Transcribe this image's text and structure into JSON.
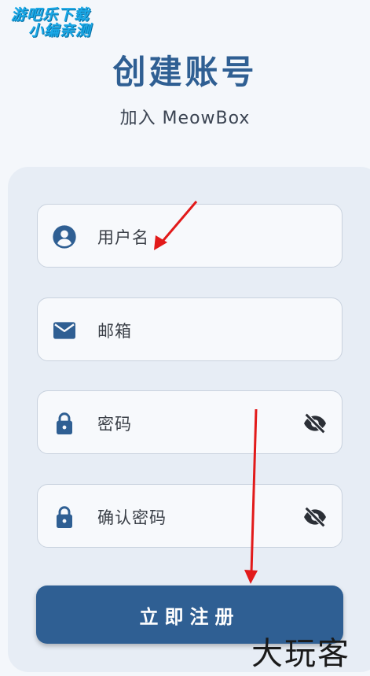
{
  "watermark_top": {
    "line1": "游吧乐下载",
    "line2": "小编亲测"
  },
  "header": {
    "title": "创建账号",
    "subtitle": "加入 MeowBox"
  },
  "form": {
    "username_label": "用户名",
    "email_label": "邮箱",
    "password_label": "密码",
    "confirm_password_label": "确认密码",
    "register_button": "立即注册"
  },
  "watermark_bottom": "大玩客",
  "colors": {
    "primary": "#2f5f93",
    "background": "#f4f7fb",
    "card": "#e7edf5",
    "field": "#f7f9fc",
    "annotation_arrow": "#e21a1a"
  },
  "icons": [
    "person-icon",
    "mail-icon",
    "lock-icon",
    "eye-off-icon"
  ]
}
